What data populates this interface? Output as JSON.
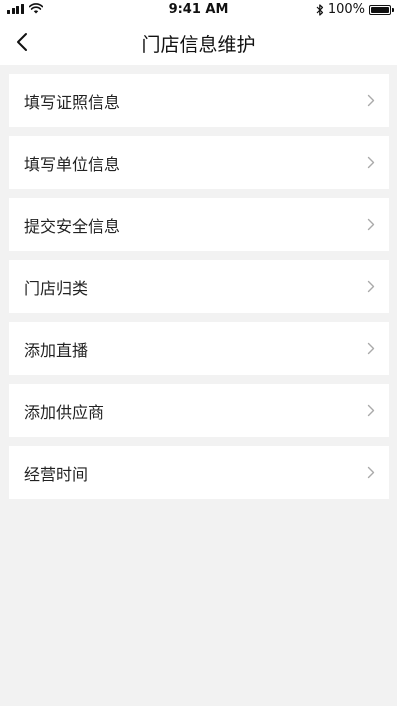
{
  "status_bar": {
    "time": "9:41 AM",
    "battery_text": "100%",
    "battery_level": 1.0,
    "icons": [
      "signal-icon",
      "wifi-icon",
      "bluetooth-icon",
      "battery-icon"
    ]
  },
  "nav": {
    "title": "门店信息维护",
    "back_icon": "chevron-left-icon"
  },
  "menu": {
    "items": [
      {
        "label": "填写证照信息"
      },
      {
        "label": "填写单位信息"
      },
      {
        "label": "提交安全信息"
      },
      {
        "label": "门店归类"
      },
      {
        "label": "添加直播"
      },
      {
        "label": "添加供应商"
      },
      {
        "label": "经营时间"
      }
    ],
    "chevron_icon": "chevron-right-icon"
  },
  "colors": {
    "background": "#f2f2f2",
    "surface": "#ffffff",
    "text": "#222222",
    "chevron": "#aaaaaa"
  }
}
